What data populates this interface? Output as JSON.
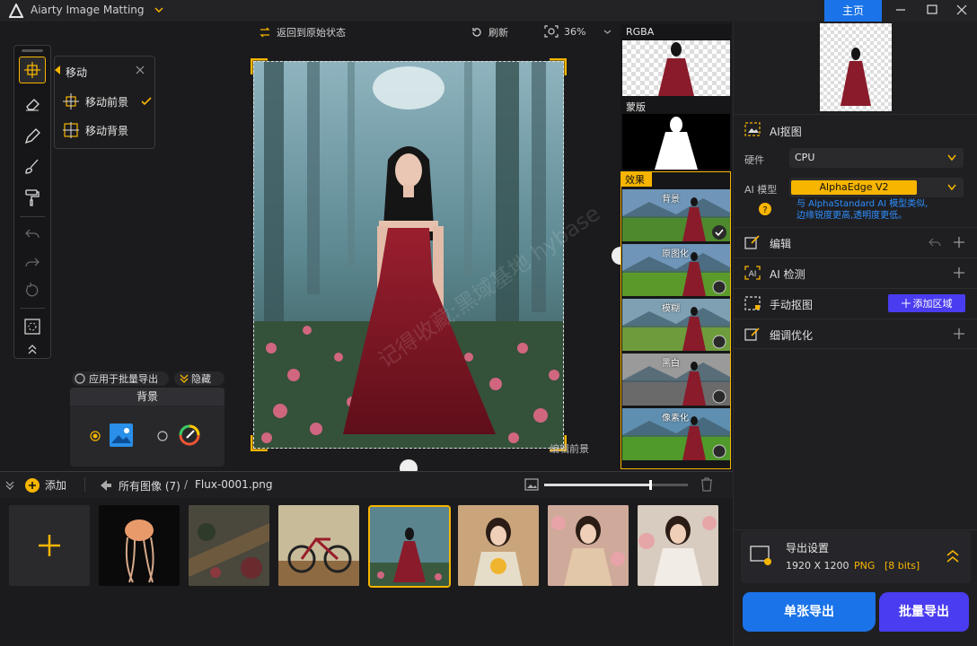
{
  "app": {
    "title": "Aiarty Image Matting",
    "home_tab": "主页"
  },
  "canvas_toolbar": {
    "reset": "返回到原始状态",
    "refresh": "刷新",
    "zoom": "36%"
  },
  "move_popup": {
    "title": "移动",
    "items": [
      "移动前景",
      "移动背景"
    ]
  },
  "batch": {
    "apply_label": "应用于批量导出",
    "hide_label": "隐藏"
  },
  "background_panel": {
    "title": "背景"
  },
  "overlay_label": "编辑前景",
  "watermark": "记得收藏:黑域基地 hybase",
  "preview": {
    "rgba_label": "RGBA",
    "mask_label": "蒙版",
    "effect_label": "效果",
    "effect_items": [
      "背景",
      "原图化",
      "模糊",
      "黑白",
      "像素化"
    ]
  },
  "right_panel": {
    "ai_matting": {
      "label": "AI抠图",
      "hardware_label": "硬件",
      "hardware_value": "CPU",
      "model_label": "AI 模型",
      "model_value": "AlphaEdge  V2",
      "model_desc": "与 AlphaStandard AI 模型类似,\n边缘锐度更高,透明度更低。"
    },
    "edit": {
      "label": "编辑"
    },
    "ai_detect": {
      "label": "AI 检测"
    },
    "manual": {
      "label": "手动抠图",
      "add_region": "添加区域"
    },
    "refine": {
      "label": "细调优化"
    },
    "export_settings": {
      "label": "导出设置",
      "size": "1920 X 1200",
      "format": "PNG",
      "bits": "[8 bits]"
    },
    "single_export": "单张导出",
    "batch_export": "批量导出"
  },
  "bottom": {
    "add_label": "添加",
    "all_images": "所有图像 (7)",
    "separator": "/",
    "filename": "Flux-0001.png",
    "slider_value": 0.74
  },
  "colors": {
    "accent": "#f7b500",
    "blue": "#1a73e8"
  }
}
